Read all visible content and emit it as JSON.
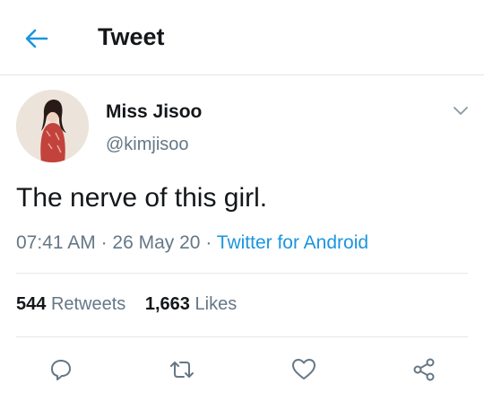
{
  "header": {
    "back_icon": "arrow-left-icon",
    "title": "Tweet"
  },
  "tweet": {
    "author": {
      "display_name": "Miss Jisoo",
      "handle": "@kimjisoo"
    },
    "text": "The nerve of this girl.",
    "time": "07:41 AM",
    "separator": "·",
    "date": "26 May 20",
    "source": "Twitter for Android",
    "stats": {
      "retweets_count": "544",
      "retweets_label": "Retweets",
      "likes_count": "1,663",
      "likes_label": "Likes"
    },
    "actions": [
      "reply-icon",
      "retweet-icon",
      "like-icon",
      "share-icon"
    ]
  },
  "colors": {
    "accent": "#1b95e0",
    "text_primary": "#14171a",
    "text_secondary": "#657786",
    "divider": "#e1e8ed"
  }
}
